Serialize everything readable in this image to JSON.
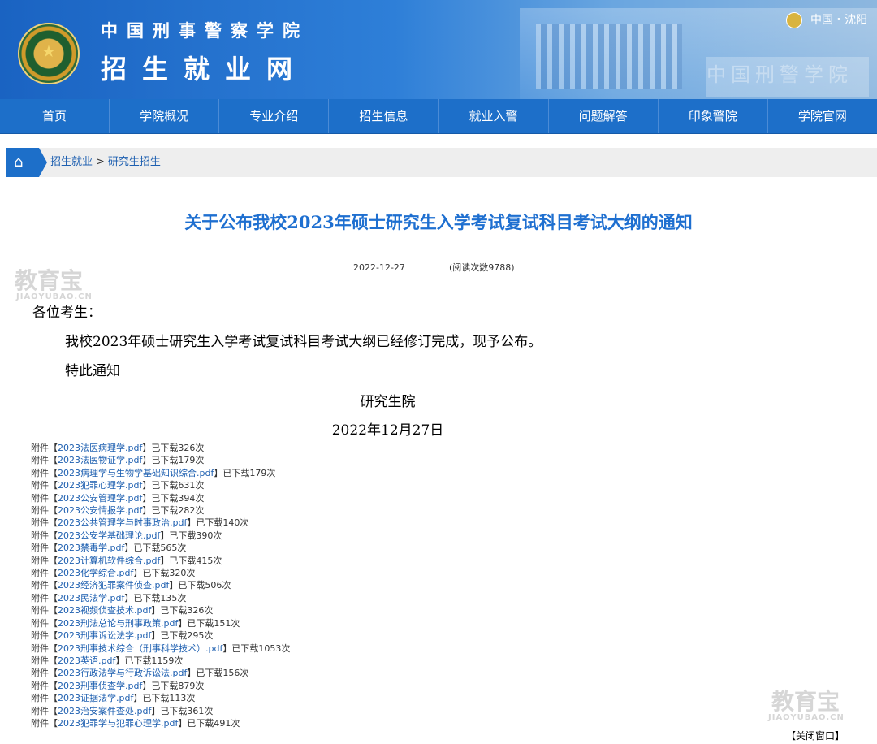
{
  "header": {
    "subtitle": "中国刑事警察学院",
    "title": "招生就业网",
    "region": "中国・沈阳",
    "watermark": "中国刑警学院"
  },
  "nav": [
    {
      "label": "首页"
    },
    {
      "label": "学院概况"
    },
    {
      "label": "专业介绍"
    },
    {
      "label": "招生信息"
    },
    {
      "label": "就业入警"
    },
    {
      "label": "问题解答"
    },
    {
      "label": "印象警院"
    },
    {
      "label": "学院官网"
    }
  ],
  "breadcrumb": {
    "level1": "招生就业",
    "separator": ">",
    "level2": "研究生招生"
  },
  "article": {
    "title": "关于公布我校2023年硕士研究生入学考试复试科目考试大纲的通知",
    "date": "2022-12-27",
    "reads": "(阅读次数9788)",
    "greeting": "各位考生：",
    "para1": "我校2023年硕士研究生入学考试复试科目考试大纲已经修订完成，现予公布。",
    "para2": "特此通知",
    "signature": "研究生院",
    "sign_date": "2022年12月27日"
  },
  "attachments": [
    {
      "prefix": "附件【",
      "name": "2023法医病理学.pdf",
      "suffix": "】已下载326次"
    },
    {
      "prefix": "附件【",
      "name": "2023法医物证学.pdf",
      "suffix": "】已下载179次"
    },
    {
      "prefix": "附件【",
      "name": "2023病理学与生物学基础知识综合.pdf",
      "suffix": "】已下载179次"
    },
    {
      "prefix": "附件【",
      "name": "2023犯罪心理学.pdf",
      "suffix": "】已下载631次"
    },
    {
      "prefix": "附件【",
      "name": "2023公安管理学.pdf",
      "suffix": "】已下载394次"
    },
    {
      "prefix": "附件【",
      "name": "2023公安情报学.pdf",
      "suffix": "】已下载282次"
    },
    {
      "prefix": "附件【",
      "name": "2023公共管理学与时事政治.pdf",
      "suffix": "】已下载140次"
    },
    {
      "prefix": "附件【",
      "name": "2023公安学基础理论.pdf",
      "suffix": "】已下载390次"
    },
    {
      "prefix": "附件【",
      "name": "2023禁毒学.pdf",
      "suffix": "】已下载565次"
    },
    {
      "prefix": "附件【",
      "name": "2023计算机软件综合.pdf",
      "suffix": "】已下载415次"
    },
    {
      "prefix": "附件【",
      "name": "2023化学综合.pdf",
      "suffix": "】已下载320次"
    },
    {
      "prefix": "附件【",
      "name": "2023经济犯罪案件侦查.pdf",
      "suffix": "】已下载506次"
    },
    {
      "prefix": "附件【",
      "name": "2023民法学.pdf",
      "suffix": "】已下载135次"
    },
    {
      "prefix": "附件【",
      "name": "2023视频侦查技术.pdf",
      "suffix": "】已下载326次"
    },
    {
      "prefix": "附件【",
      "name": "2023刑法总论与刑事政策.pdf",
      "suffix": "】已下载151次"
    },
    {
      "prefix": "附件【",
      "name": "2023刑事诉讼法学.pdf",
      "suffix": "】已下载295次"
    },
    {
      "prefix": "附件【",
      "name": "2023刑事技术综合（刑事科学技术）.pdf",
      "suffix": "】已下载1053次"
    },
    {
      "prefix": "附件【",
      "name": "2023英语.pdf",
      "suffix": "】已下载1159次"
    },
    {
      "prefix": "附件【",
      "name": "2023行政法学与行政诉讼法.pdf",
      "suffix": "】已下载156次"
    },
    {
      "prefix": "附件【",
      "name": "2023刑事侦查学.pdf",
      "suffix": "】已下载879次"
    },
    {
      "prefix": "附件【",
      "name": "2023证据法学.pdf",
      "suffix": "】已下载113次"
    },
    {
      "prefix": "附件【",
      "name": "2023治安案件查处.pdf",
      "suffix": "】已下载361次"
    },
    {
      "prefix": "附件【",
      "name": "2023犯罪学与犯罪心理学.pdf",
      "suffix": "】已下载491次"
    }
  ],
  "footer": {
    "close_prefix": "【",
    "close_label": "关闭窗口",
    "close_suffix": "】"
  },
  "watermarks": {
    "brand": "教育宝",
    "domain": "JIAOYUBAO.CN"
  },
  "colors": {
    "nav_bg": "#1d6fc9",
    "title_blue": "#1e6fd0",
    "link_blue": "#1d5fb0"
  }
}
